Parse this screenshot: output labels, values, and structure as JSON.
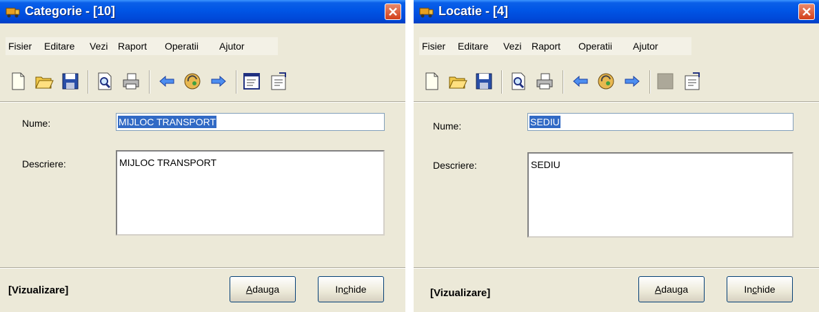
{
  "windows": [
    {
      "title": "Categorie - [10]",
      "menu": [
        "Fisier",
        "Editare",
        "Vezi",
        "Raport",
        "Operatii",
        "Ajutor"
      ],
      "toolbar_icons": [
        "new-icon",
        "open-folder-icon",
        "save-icon",
        "print-preview-icon",
        "print-icon",
        "arrow-left-icon",
        "refresh-icon",
        "arrow-right-icon",
        "list-icon",
        "properties-icon"
      ],
      "fields": {
        "nume_label": "Nume:",
        "nume_value": "MIJLOC TRANSPORT",
        "descriere_label": "Descriere:",
        "descriere_value": "MIJLOC TRANSPORT"
      },
      "status": "[Vizualizare]",
      "buttons": {
        "adauga_first": "A",
        "adauga_rest": "dauga",
        "inchide_pre": "In",
        "inchide_hot": "c",
        "inchide_rest": "hide"
      }
    },
    {
      "title": "Locatie - [4]",
      "menu": [
        "Fisier",
        "Editare",
        "Vezi",
        "Raport",
        "Operatii",
        "Ajutor"
      ],
      "toolbar_icons": [
        "new-icon",
        "open-folder-icon",
        "save-icon",
        "print-preview-icon",
        "print-icon",
        "arrow-left-icon",
        "refresh-icon",
        "arrow-right-icon",
        "disabled-icon",
        "properties-icon"
      ],
      "fields": {
        "nume_label": "Nume:",
        "nume_value": "SEDIU",
        "descriere_label": "Descriere:",
        "descriere_value": "SEDIU"
      },
      "status": "[Vizualizare]",
      "buttons": {
        "adauga_first": "A",
        "adauga_rest": "dauga",
        "inchide_pre": "In",
        "inchide_hot": "c",
        "inchide_rest": "hide"
      }
    }
  ],
  "colors": {
    "titlebar": "#0055e5",
    "window_bg": "#ece9d8",
    "selection": "#316ac5",
    "close_button": "#d33f1a"
  }
}
